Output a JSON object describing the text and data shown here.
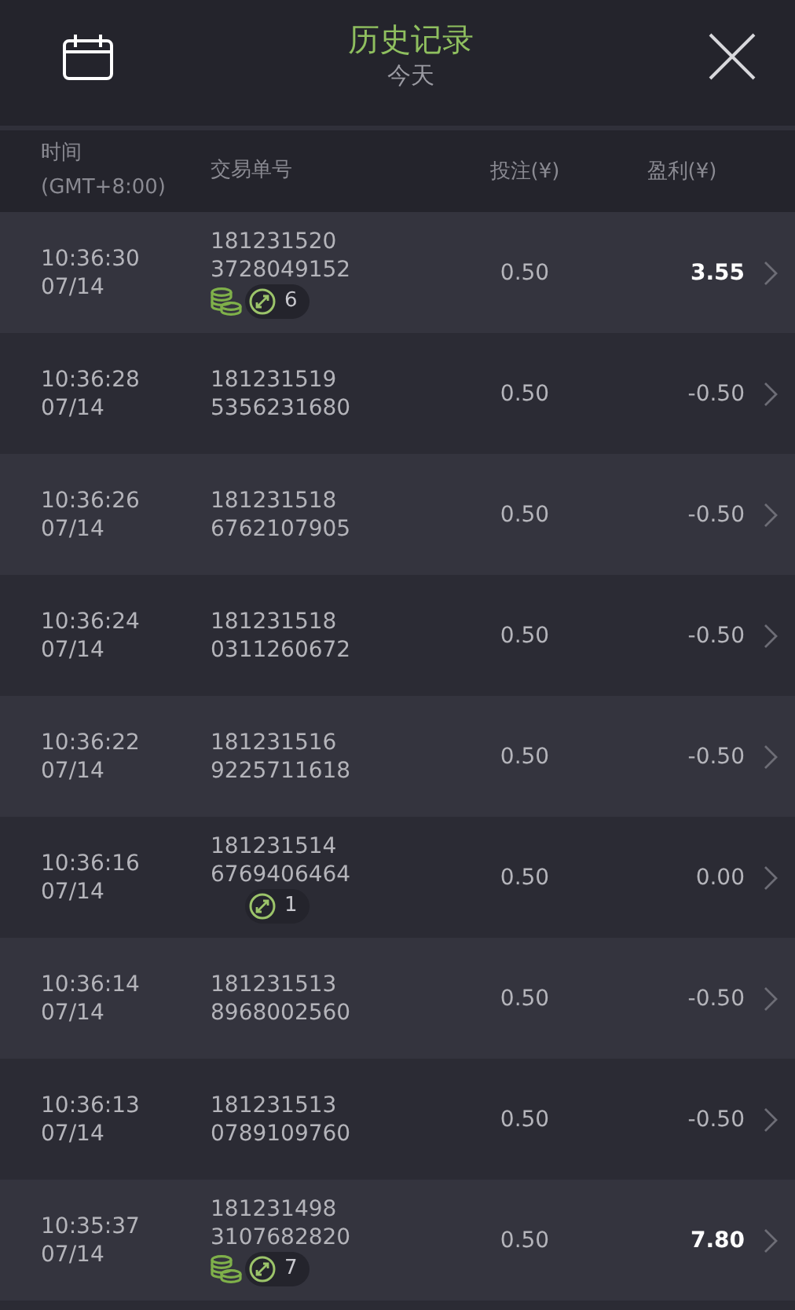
{
  "header": {
    "title": "历史记录",
    "subtitle": "今天"
  },
  "columns": [
    {
      "label": "时间",
      "sublabel": "(GMT+8:00)"
    },
    {
      "label": "交易单号"
    },
    {
      "label": "投注(¥)"
    },
    {
      "label": "盈利(¥)"
    }
  ],
  "rows": [
    {
      "time": "10:36:30",
      "date": "07/14",
      "id_line1": "181231520",
      "id_line2": "3728049152",
      "bet": "0.50",
      "profit": "3.55",
      "won": true,
      "coins": true,
      "count": "6"
    },
    {
      "time": "10:36:28",
      "date": "07/14",
      "id_line1": "181231519",
      "id_line2": "5356231680",
      "bet": "0.50",
      "profit": "-0.50",
      "won": false,
      "coins": false
    },
    {
      "time": "10:36:26",
      "date": "07/14",
      "id_line1": "181231518",
      "id_line2": "6762107905",
      "bet": "0.50",
      "profit": "-0.50",
      "won": false,
      "coins": false
    },
    {
      "time": "10:36:24",
      "date": "07/14",
      "id_line1": "181231518",
      "id_line2": "0311260672",
      "bet": "0.50",
      "profit": "-0.50",
      "won": false,
      "coins": false
    },
    {
      "time": "10:36:22",
      "date": "07/14",
      "id_line1": "181231516",
      "id_line2": "9225711618",
      "bet": "0.50",
      "profit": "-0.50",
      "won": false,
      "coins": false
    },
    {
      "time": "10:36:16",
      "date": "07/14",
      "id_line1": "181231514",
      "id_line2": "6769406464",
      "bet": "0.50",
      "profit": "0.00",
      "won": false,
      "coins": false,
      "count": "1"
    },
    {
      "time": "10:36:14",
      "date": "07/14",
      "id_line1": "181231513",
      "id_line2": "8968002560",
      "bet": "0.50",
      "profit": "-0.50",
      "won": false,
      "coins": false
    },
    {
      "time": "10:36:13",
      "date": "07/14",
      "id_line1": "181231513",
      "id_line2": "0789109760",
      "bet": "0.50",
      "profit": "-0.50",
      "won": false,
      "coins": false
    },
    {
      "time": "10:35:37",
      "date": "07/14",
      "id_line1": "181231498",
      "id_line2": "3107682820",
      "bet": "0.50",
      "profit": "7.80",
      "won": true,
      "coins": true,
      "count": "7"
    }
  ]
}
